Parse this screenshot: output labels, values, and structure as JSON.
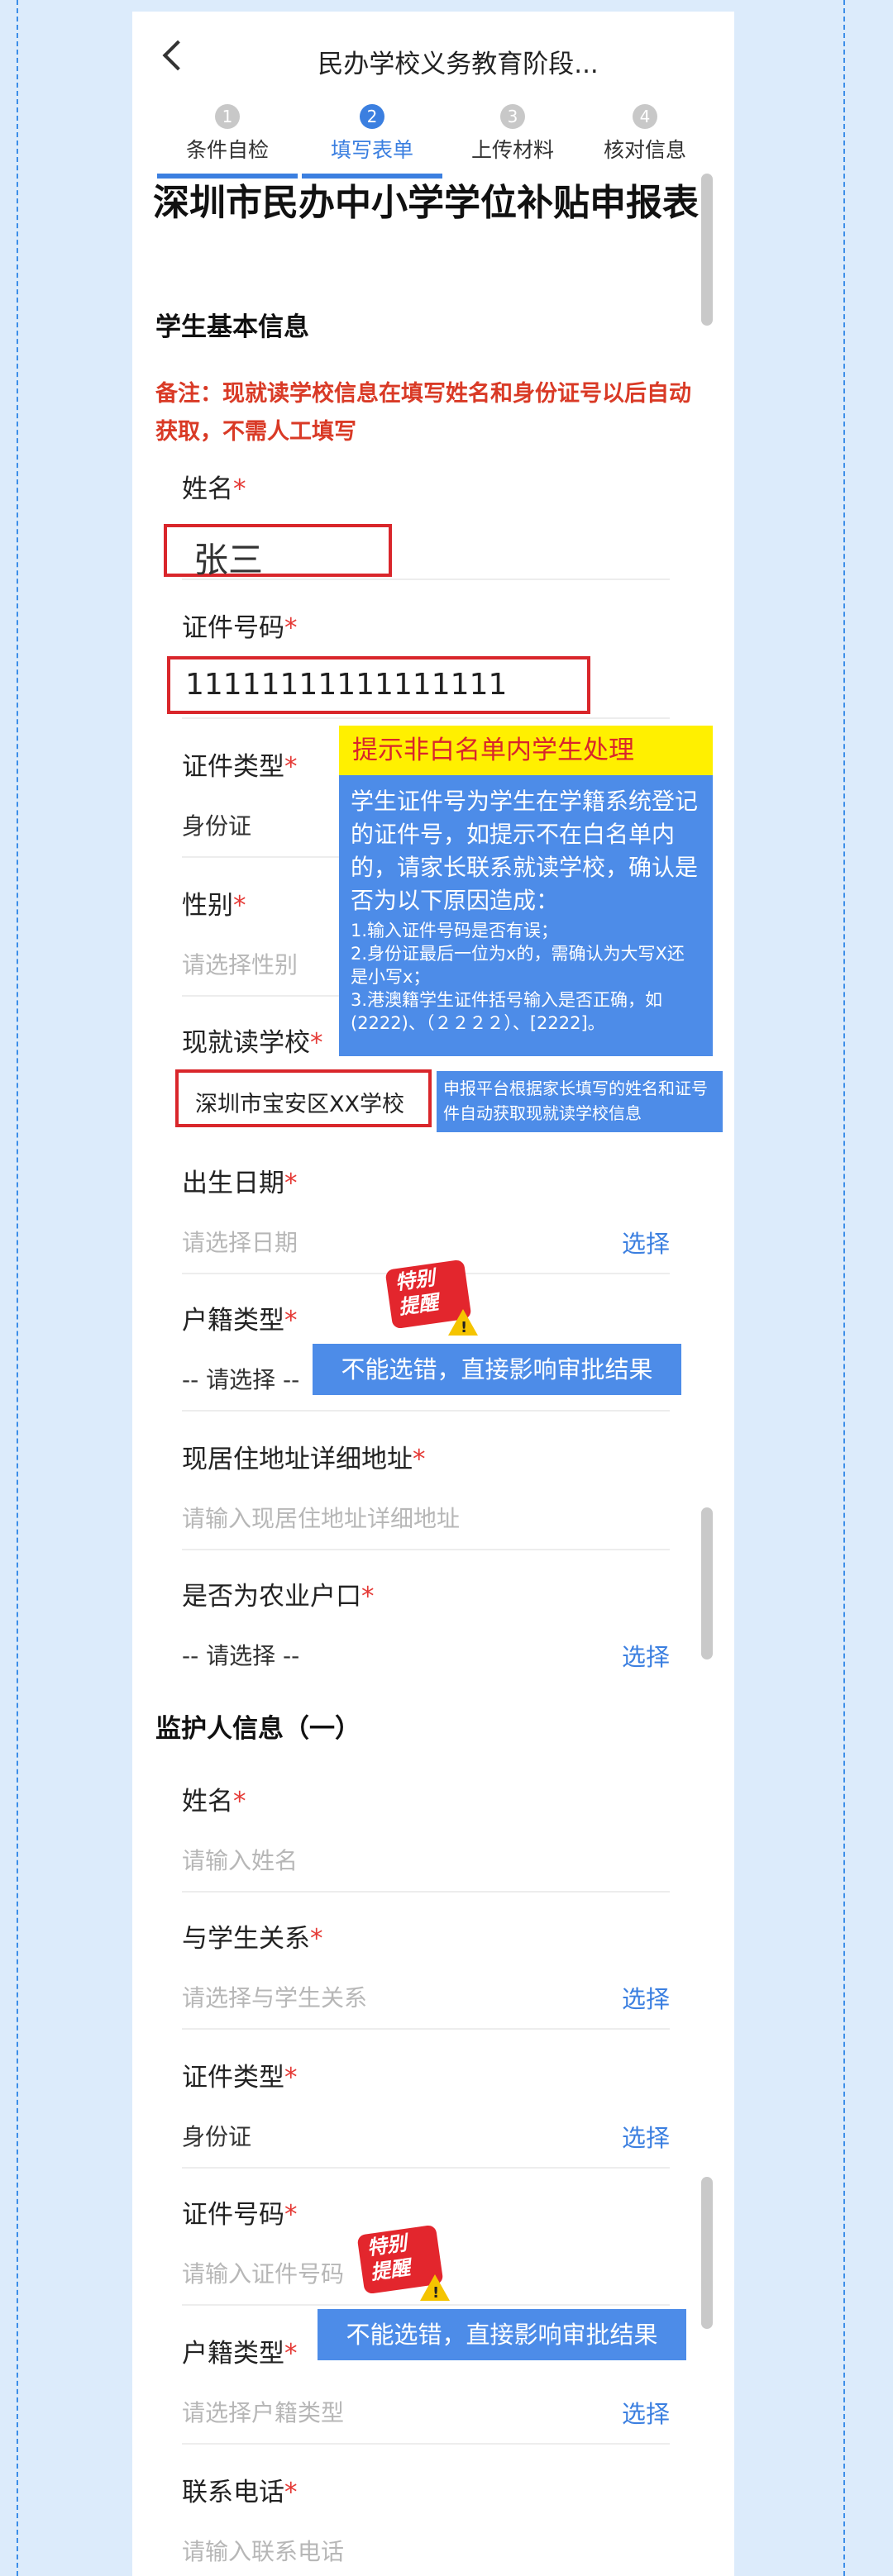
{
  "nav": {
    "title": "民办学校义务教育阶段..."
  },
  "steps": [
    {
      "num": "1",
      "label": "条件自检"
    },
    {
      "num": "2",
      "label": "填写表单"
    },
    {
      "num": "3",
      "label": "上传材料"
    },
    {
      "num": "4",
      "label": "核对信息"
    }
  ],
  "form_title": "深圳市民办中小学学位补贴申报表",
  "sections": {
    "student": "学生基本信息",
    "guardian": "监护人信息（一）"
  },
  "remark": "备注：现就读学校信息在填写姓名和身份证号以后自动获取，不需人工填写",
  "student": {
    "name": {
      "label": "姓名",
      "value": "张三"
    },
    "id_number": {
      "label": "证件号码",
      "value": "11111111111111111"
    },
    "id_type": {
      "label": "证件类型",
      "value": "身份证"
    },
    "gender": {
      "label": "性别",
      "placeholder": "请选择性别"
    },
    "school": {
      "label": "现就读学校",
      "value": "深圳市宝安区XX学校"
    },
    "birth": {
      "label": "出生日期",
      "placeholder": "请选择日期",
      "action": "选择"
    },
    "hukou": {
      "label": "户籍类型",
      "value": "-- 请选择 --"
    },
    "address": {
      "label": "现居住地址详细地址",
      "placeholder": "请输入现居住地址详细地址"
    },
    "agri": {
      "label": "是否为农业户口",
      "value": "-- 请选择 --",
      "action": "选择"
    }
  },
  "guardian": {
    "name": {
      "label": "姓名",
      "placeholder": "请输入姓名"
    },
    "relation": {
      "label": "与学生关系",
      "placeholder": "请选择与学生关系",
      "action": "选择"
    },
    "id_type": {
      "label": "证件类型",
      "value": "身份证",
      "action": "选择"
    },
    "id_number": {
      "label": "证件号码",
      "placeholder": "请输入证件号码"
    },
    "hukou": {
      "label": "户籍类型",
      "placeholder": "请选择户籍类型",
      "action": "选择"
    },
    "phone": {
      "label": "联系电话",
      "placeholder": "请输入联系电话"
    }
  },
  "annotations": {
    "whitelist_title": "提示非白名单内学生处理",
    "whitelist_body": "学生证件号为学生在学籍系统登记的证件号，如提示不在白名单内的，请家长联系就读学校，确认是否为以下原因造成：",
    "whitelist_items": [
      "1.输入证件号码是否有误；",
      "2.身份证最后一位为x的，需确认为大写X还是小写x；",
      "3.港澳籍学生证件括号输入是否正确，如(2222)、（２２２２）、[2222]。"
    ],
    "school_note": "申报平台根据家长填写的姓名和证号件自动获取现就读学校信息",
    "warning1": "不能选错，直接影响审批结果",
    "warning2": "不能选错，直接影响审批结果",
    "badge_text_1": "特别",
    "badge_text_2": "提醒"
  },
  "colors": {
    "accent": "#3b7fe0",
    "required": "#e53935",
    "remark": "#d93a26",
    "highlight": "#d9262b"
  }
}
